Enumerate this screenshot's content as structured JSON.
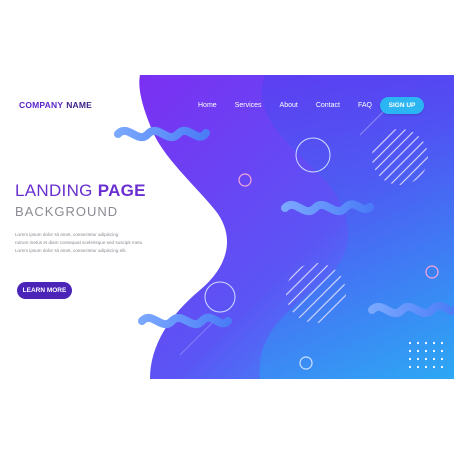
{
  "brand": {
    "name_part1": "COMPANY",
    "name_part2": "NAME"
  },
  "nav": {
    "items": [
      "Home",
      "Services",
      "About",
      "Contact",
      "FAQ"
    ]
  },
  "signup_label": "SIGN UP",
  "hero": {
    "title_regular": "LANDING",
    "title_bold": "PAGE",
    "subtitle": "BACKGROUND",
    "paragraph": [
      "Lorem ipsum dolor sit amet, consectetur adipiscing",
      "rutrum metus et diam consequat scelerisque sed suscipit metu",
      "Lorem ipsum dolor sit amet, consectetur adipiscing elit."
    ],
    "cta_label": "LEARN MORE"
  },
  "colors": {
    "primary": "#6a2fd0",
    "accent": "#2bb6f3",
    "cta": "#4b24b8",
    "gradient_start": "#7a2ff0",
    "gradient_end": "#2aa9f2"
  }
}
